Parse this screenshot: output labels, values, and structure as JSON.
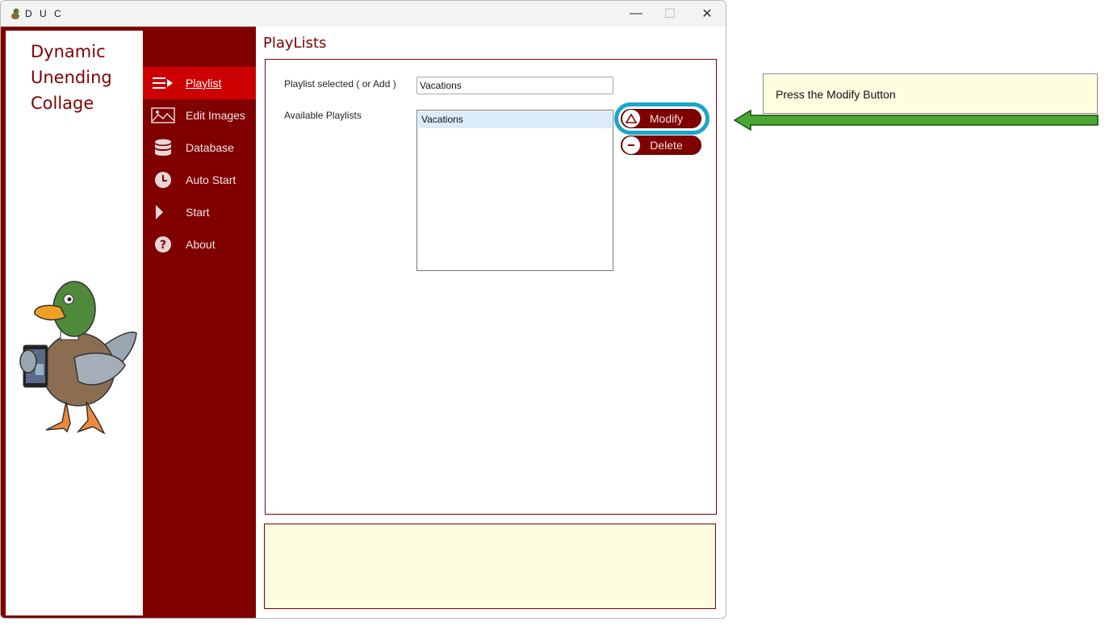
{
  "window": {
    "title": "D U C",
    "minimize_glyph": "—",
    "maximize_glyph": "☐",
    "close_glyph": "✕"
  },
  "logo": {
    "line1": "Dynamic",
    "line2": "Unending",
    "line3": "Collage"
  },
  "nav": {
    "items": [
      {
        "label": "Playlist",
        "icon": "playlist-icon",
        "active": true
      },
      {
        "label": "Edit Images",
        "icon": "image-icon",
        "active": false
      },
      {
        "label": "Database",
        "icon": "database-icon",
        "active": false
      },
      {
        "label": "Auto Start",
        "icon": "clock-icon",
        "active": false
      },
      {
        "label": "Start",
        "icon": "play-icon",
        "active": false
      },
      {
        "label": "About",
        "icon": "question-icon",
        "active": false
      }
    ]
  },
  "page": {
    "title": "PlayLists",
    "selected_label": "Playlist selected ( or Add )",
    "selected_value": "Vacations",
    "available_label": "Available Playlists",
    "playlists": [
      "Vacations"
    ],
    "modify_label": "Modify",
    "delete_label": "Delete"
  },
  "callout": {
    "text": "Press the Modify Button"
  },
  "colors": {
    "brand": "#800000",
    "nav_active": "#cc0000",
    "highlight": "#1aa6c8",
    "arrow": "#4aa832",
    "message_bg": "#fffddf"
  }
}
